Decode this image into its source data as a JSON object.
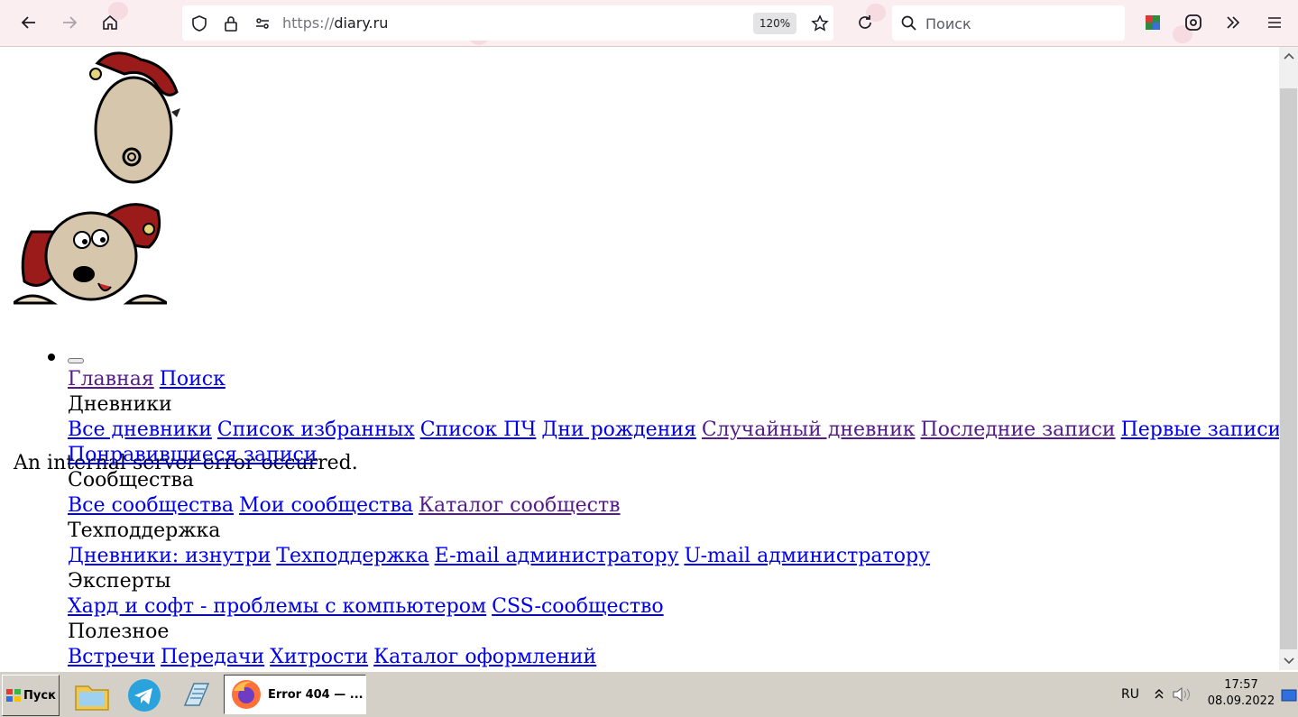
{
  "browser": {
    "url_scheme": "https://",
    "url_host": "diary.ru",
    "zoom": "120%",
    "search_placeholder": "Поиск"
  },
  "page": {
    "error_message": "An internal server error occurred.",
    "menu": {
      "main_links": [
        "Главная",
        "Поиск"
      ],
      "sections": [
        {
          "title": "Дневники",
          "links": [
            "Все дневники",
            "Список избранных",
            "Список ПЧ",
            "Дни рождения",
            "Случайный дневник",
            "Последние записи",
            "Первые записи",
            "Понравившиеся записи"
          ]
        },
        {
          "title": "Сообщества",
          "links": [
            "Все сообщества",
            "Мои сообщества",
            "Каталог сообществ"
          ]
        },
        {
          "title": "Техподдержка",
          "links": [
            "Дневники: изнутри",
            "Техподдержка",
            "E-mail администратору",
            "U-mail администратору"
          ]
        },
        {
          "title": "Эксперты",
          "links": [
            "Хард и софт - проблемы с компьютером",
            "CSS-сообщество"
          ]
        },
        {
          "title": "Полезное",
          "links": [
            "Встречи",
            "Передачи",
            "Хитрости",
            "Каталог оформлений"
          ]
        }
      ]
    }
  },
  "taskbar": {
    "start_label": "Пуск",
    "active_task": "Error 404 — ...",
    "lang": "RU",
    "time": "17:57",
    "date": "08.09.2022"
  }
}
